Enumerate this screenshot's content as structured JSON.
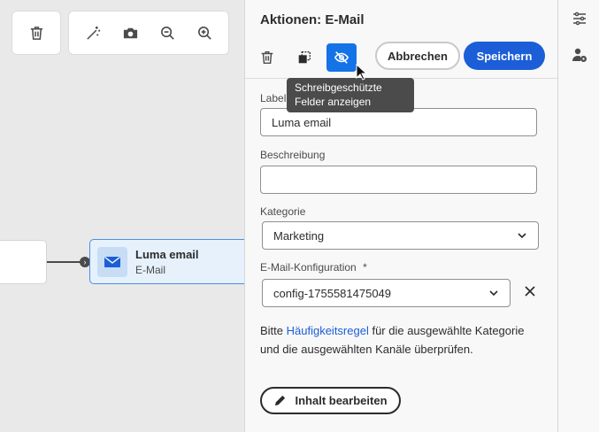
{
  "canvas": {
    "toolbar_icons": [
      "trash-icon",
      "magic-wand-icon",
      "camera-icon",
      "zoom-out-icon",
      "zoom-in-icon"
    ],
    "node": {
      "title": "Luma email",
      "subtitle": "E-Mail"
    }
  },
  "panel": {
    "title": "Aktionen: E-Mail",
    "cancel_label": "Abbrechen",
    "save_label": "Speichern",
    "tooltip": "Schreibgeschützte Felder anzeigen",
    "label_label": "Label",
    "label_value": "Luma email",
    "description_label": "Beschreibung",
    "description_value": "",
    "category_label": "Kategorie",
    "category_value": "Marketing",
    "config_label": "E-Mail-Konfiguration",
    "config_required": "*",
    "config_value": "config-1755581475049",
    "info_prefix": "Bitte ",
    "info_link": "Häufigkeitsregel",
    "info_suffix": " für die ausgewählte Kategorie und die ausgewählten Kanäle überprüfen.",
    "edit_content_label": "Inhalt bearbeiten"
  },
  "colors": {
    "accent": "#1c5ed8",
    "toggle_active": "#1473e6",
    "node_bg": "#e6f1fc"
  }
}
